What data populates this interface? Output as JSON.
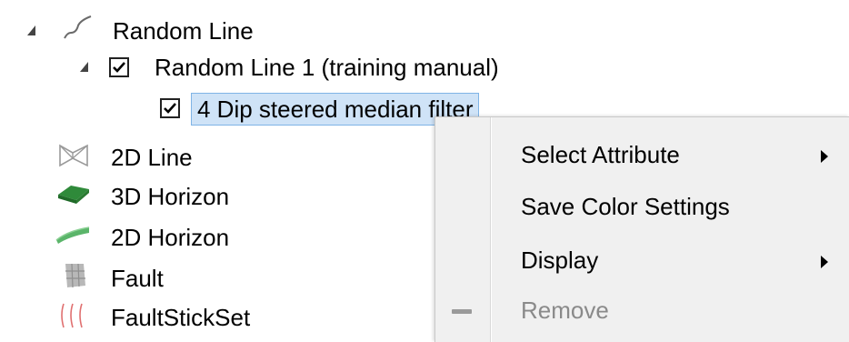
{
  "tree": {
    "random_line": {
      "label": "Random Line",
      "icon": "random-line-icon"
    },
    "random_line_1": {
      "label": "Random Line 1 (training manual)",
      "checked": true
    },
    "dip_filter": {
      "label": "4 Dip steered median filter",
      "checked": true,
      "selected": true
    },
    "line_2d": {
      "label": "2D Line",
      "icon": "2d-line-icon"
    },
    "horizon_3d": {
      "label": "3D Horizon",
      "icon": "3d-horizon-icon"
    },
    "horizon_2d": {
      "label": "2D Horizon",
      "icon": "2d-horizon-icon"
    },
    "fault": {
      "label": "Fault",
      "icon": "fault-icon"
    },
    "faultstickset": {
      "label": "FaultStickSet",
      "icon": "faultstickset-icon"
    }
  },
  "context_menu": {
    "items": [
      {
        "label": "Select Attribute",
        "submenu": true,
        "enabled": true
      },
      {
        "label": "Save Color Settings",
        "submenu": false,
        "enabled": true
      },
      {
        "label": "Display",
        "submenu": true,
        "enabled": true
      },
      {
        "label": "Remove",
        "submenu": false,
        "enabled": false,
        "icon": "remove-icon"
      }
    ]
  },
  "colors": {
    "selection_bg": "#cfe3f7",
    "selection_border": "#7fb4e6",
    "menu_bg": "#f0f0f0",
    "disabled_text": "#8a8a8a"
  }
}
